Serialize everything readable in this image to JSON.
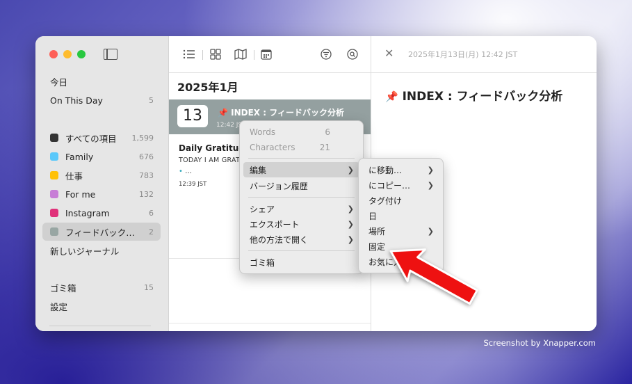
{
  "sidebar": {
    "top_items": [
      {
        "label": "今日",
        "count": ""
      },
      {
        "label": "On This Day",
        "count": "5"
      }
    ],
    "journals": [
      {
        "label": "すべての項目",
        "count": "1,599",
        "color": "#333333"
      },
      {
        "label": "Family",
        "count": "676",
        "color": "#5ac8fa"
      },
      {
        "label": "仕事",
        "count": "783",
        "color": "#ffc107"
      },
      {
        "label": "For me",
        "count": "132",
        "color": "#c77dd6"
      },
      {
        "label": "Instagram",
        "count": "6",
        "color": "#e0317a"
      },
      {
        "label": "フィードバック…",
        "count": "2",
        "color": "#98a6a3",
        "selected": true
      }
    ],
    "new_journal": "新しいジャーナル",
    "trash": {
      "label": "ゴミ箱",
      "count": "15"
    },
    "settings": "設定"
  },
  "list": {
    "month": "2025年1月",
    "entries": [
      {
        "day": "13",
        "title": "INDEX : フィードバック分析",
        "time": "12:42 JST",
        "pin_icon": "pushpin-icon"
      },
      {
        "title": "Daily Gratitud",
        "body": "TODAY I AM GRAT",
        "dots": "…",
        "time": "12:39 JST"
      }
    ]
  },
  "detail": {
    "date": "2025年1月13日(月) 12:42 JST",
    "title": "INDEX : フィードバック分析"
  },
  "context_menu": {
    "words_label": "Words",
    "words_value": "6",
    "chars_label": "Characters",
    "chars_value": "21",
    "edit": "編集",
    "version_history": "バージョン履歴",
    "share": "シェア",
    "export": "エクスポート",
    "open_with": "他の方法で開く",
    "trash": "ゴミ箱"
  },
  "submenu": {
    "move_to": "に移動…",
    "copy_to": "にコピー…",
    "tag": "タグ付け",
    "date": "日",
    "place": "場所",
    "pin": "固定",
    "favorite": "お気に入"
  },
  "credit": "Screenshot by Xnapper.com"
}
